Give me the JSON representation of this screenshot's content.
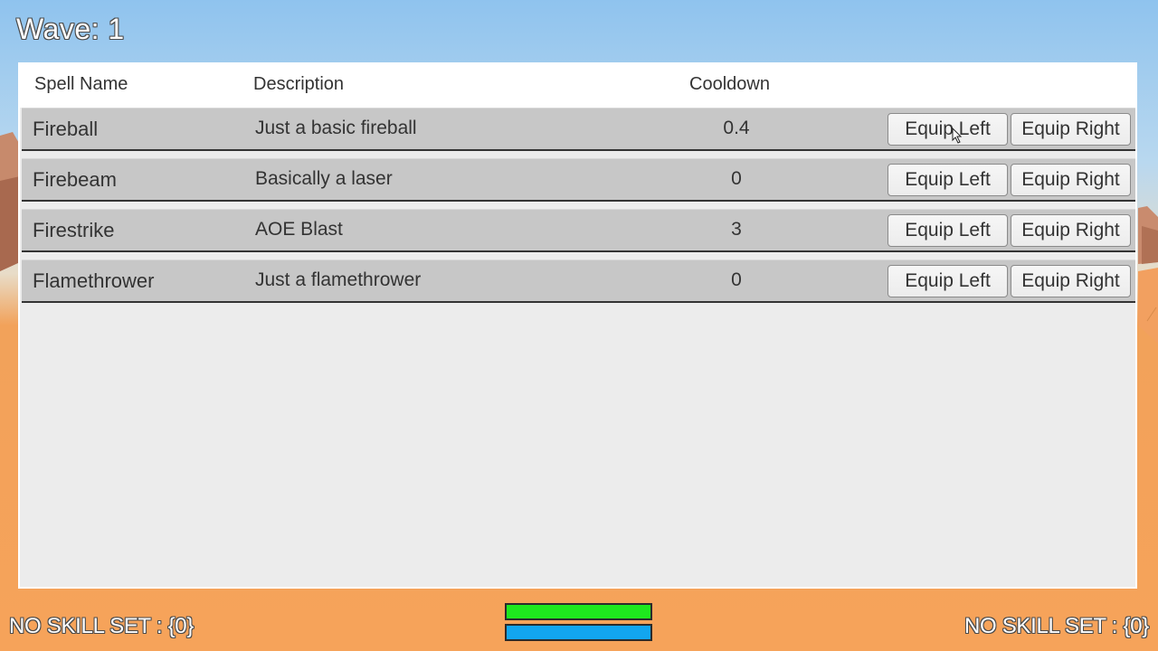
{
  "hud": {
    "wave_text": "Wave: 1",
    "skill_left": "NO SKILL SET : {0}",
    "skill_right": "NO SKILL SET : {0}",
    "health_fraction": 1.0,
    "mana_fraction": 1.0,
    "health_color": "#1ee81e",
    "mana_color": "#12a6ef"
  },
  "table": {
    "headers": {
      "name": "Spell Name",
      "description": "Description",
      "cooldown": "Cooldown"
    },
    "rows": [
      {
        "name": "Fireball",
        "description": "Just a basic fireball",
        "cooldown": "0.4",
        "equip_left": "Equip Left",
        "equip_right": "Equip Right"
      },
      {
        "name": "Firebeam",
        "description": "Basically a laser",
        "cooldown": "0",
        "equip_left": "Equip Left",
        "equip_right": "Equip Right"
      },
      {
        "name": "Firestrike",
        "description": "AOE Blast",
        "cooldown": "3",
        "equip_left": "Equip Left",
        "equip_right": "Equip Right"
      },
      {
        "name": "Flamethrower",
        "description": "Just a flamethrower",
        "cooldown": "0",
        "equip_left": "Equip Left",
        "equip_right": "Equip Right"
      }
    ]
  },
  "colors": {
    "sky": "#a9cdee",
    "sand": "#f6a35a",
    "rock": "#c98a6a",
    "row_bg": "#c7c7c7",
    "panel_bg": "#ececec"
  }
}
